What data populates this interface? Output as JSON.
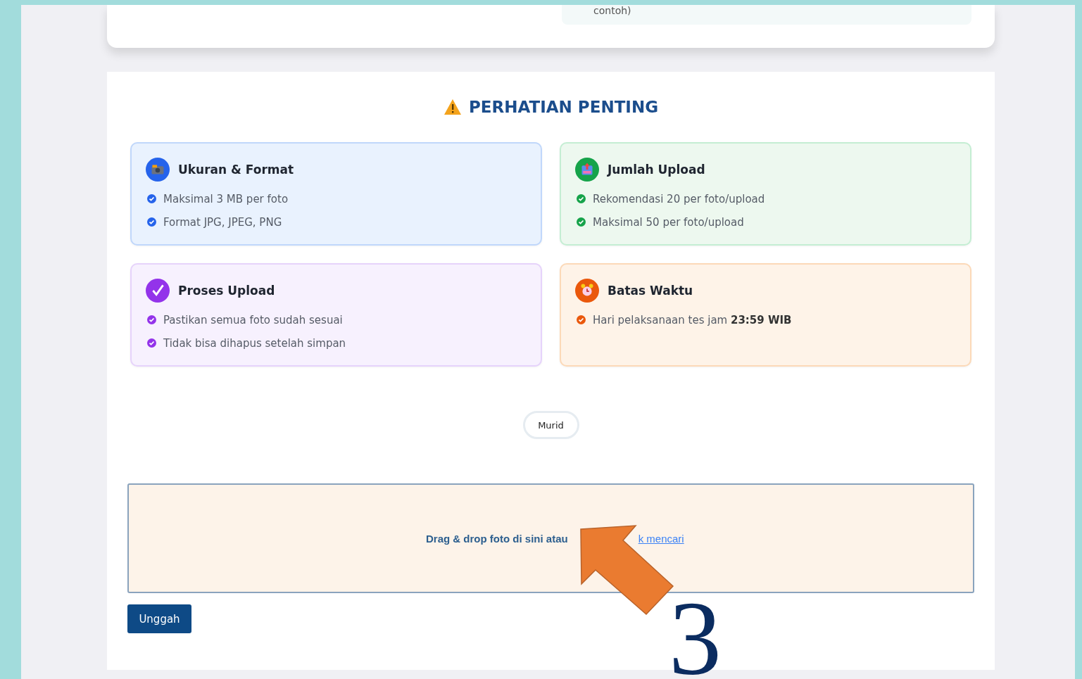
{
  "top_card": {
    "note_text": "contoh)"
  },
  "notice": {
    "title": "PERHATIAN PENTING",
    "cards": [
      {
        "kind": "camera",
        "color": "#2563eb",
        "title": "Ukuran & Format",
        "items": [
          "Maksimal 3 MB per foto",
          "Format JPG, JPEG, PNG"
        ]
      },
      {
        "kind": "upload",
        "color": "#16a34a",
        "title": "Jumlah Upload",
        "items": [
          "Rekomendasi 20 per foto/upload",
          "Maksimal 50 per foto/upload"
        ]
      },
      {
        "kind": "check",
        "color": "#9333ea",
        "title": "Proses Upload",
        "items": [
          "Pastikan semua foto sudah sesuai",
          "Tidak bisa dihapus setelah simpan"
        ]
      },
      {
        "kind": "alarm",
        "color": "#ea580c",
        "title": "Batas Waktu",
        "items": [
          "Hari pelaksanaan tes jam  **23:59 WIB**"
        ]
      }
    ]
  },
  "role_chip": {
    "label": "Murid"
  },
  "drop_zone": {
    "text": "Drag & drop foto di sini atau",
    "link": "k mencari"
  },
  "upload_button": {
    "label": "Unggah"
  },
  "annotation": {
    "number": "3"
  }
}
